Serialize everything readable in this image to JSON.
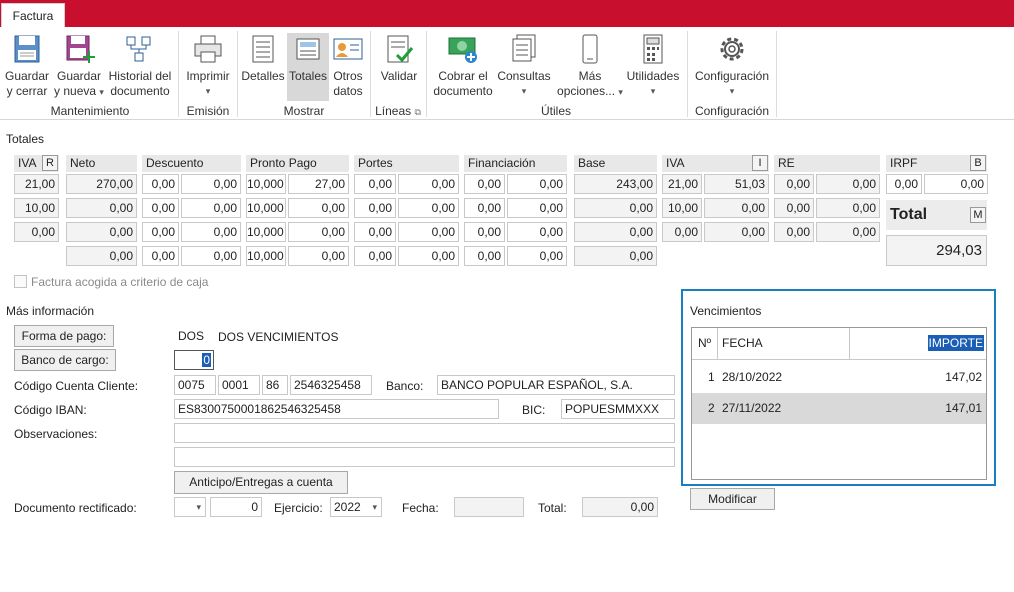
{
  "tab": "Factura",
  "ribbon": {
    "mantenimiento": {
      "label": "Mantenimiento",
      "guardar": "Guardar",
      "guardar2": "y cerrar",
      "nueva": "Guardar",
      "nueva2": "y nueva",
      "historial": "Historial del",
      "historial2": "documento"
    },
    "emision": {
      "label": "Emisión",
      "imprimir": "Imprimir"
    },
    "mostrar": {
      "label": "Mostrar",
      "detalles": "Detalles",
      "totales": "Totales",
      "otros": "Otros",
      "otros2": "datos"
    },
    "lineas": {
      "label": "Líneas",
      "validar": "Validar"
    },
    "utiles": {
      "label": "Útiles",
      "cobrar": "Cobrar el",
      "cobrar2": "documento",
      "consultas": "Consultas",
      "mas": "Más",
      "mas2": "opciones...",
      "utilidades": "Utilidades"
    },
    "config": {
      "label": "Configuración",
      "btn": "Configuración"
    }
  },
  "totales": {
    "title": "Totales",
    "headers": {
      "iva": "IVA",
      "iva_btn": "R",
      "neto": "Neto",
      "descuento": "Descuento",
      "pronto": "Pronto Pago",
      "portes": "Portes",
      "financiacion": "Financiación",
      "base": "Base",
      "iva2": "IVA",
      "iva2_btn": "I",
      "re": "RE",
      "irpf": "IRPF",
      "irpf_btn": "B"
    },
    "rows": [
      [
        "21,00",
        "270,00",
        "0,00",
        "0,00",
        "10,000",
        "27,00",
        "0,00",
        "0,00",
        "0,00",
        "0,00",
        "243,00",
        "21,00",
        "51,03",
        "0,00",
        "0,00"
      ],
      [
        "10,00",
        "0,00",
        "0,00",
        "0,00",
        "10,000",
        "0,00",
        "0,00",
        "0,00",
        "0,00",
        "0,00",
        "0,00",
        "10,00",
        "0,00",
        "0,00",
        "0,00"
      ],
      [
        "0,00",
        "0,00",
        "0,00",
        "0,00",
        "10,000",
        "0,00",
        "0,00",
        "0,00",
        "0,00",
        "0,00",
        "0,00",
        "0,00",
        "0,00",
        "0,00",
        "0,00"
      ],
      [
        "",
        "0,00",
        "0,00",
        "0,00",
        "10,000",
        "0,00",
        "0,00",
        "0,00",
        "0,00",
        "0,00",
        "0,00",
        "",
        "",
        "",
        ""
      ]
    ],
    "irpf_values": [
      "0,00",
      "0,00"
    ],
    "total_label": "Total",
    "total_btn": "M",
    "total_value": "294,03",
    "caja_label": "Factura acogida a criterio de caja"
  },
  "info": {
    "title": "Más información",
    "forma_pago_btn": "Forma de pago:",
    "forma_pago_code": "DOS",
    "forma_pago_desc": "DOS VENCIMIENTOS",
    "banco_cargo_btn": "Banco de cargo:",
    "banco_cargo_value": "0",
    "ccc_label": "Código Cuenta Cliente:",
    "ccc": [
      "0075",
      "0001",
      "86",
      "2546325458"
    ],
    "banco_label": "Banco:",
    "banco_value": "BANCO POPULAR ESPAÑOL, S.A.",
    "iban_label": "Código IBAN:",
    "iban_value": "ES8300750001862546325458",
    "bic_label": "BIC:",
    "bic_value": "POPUESMMXXX",
    "obs_label": "Observaciones:",
    "anticipo_btn": "Anticipo/Entregas a cuenta",
    "doc_rect_label": "Documento rectificado:",
    "doc_num": "0",
    "ejercicio_label": "Ejercicio:",
    "ejercicio_value": "2022",
    "fecha_label": "Fecha:",
    "total_label": "Total:",
    "total_value": "0,00"
  },
  "vencimientos": {
    "title": "Vencimientos",
    "cols": [
      "Nº",
      "FECHA",
      "IMPORTE"
    ],
    "rows": [
      {
        "n": "1",
        "fecha": "28/10/2022",
        "importe": "147,02"
      },
      {
        "n": "2",
        "fecha": "27/11/2022",
        "importe": "147,01"
      }
    ],
    "modificar": "Modificar"
  },
  "colors": {
    "brand": "#c8102e",
    "focus": "#1a7fbf"
  }
}
